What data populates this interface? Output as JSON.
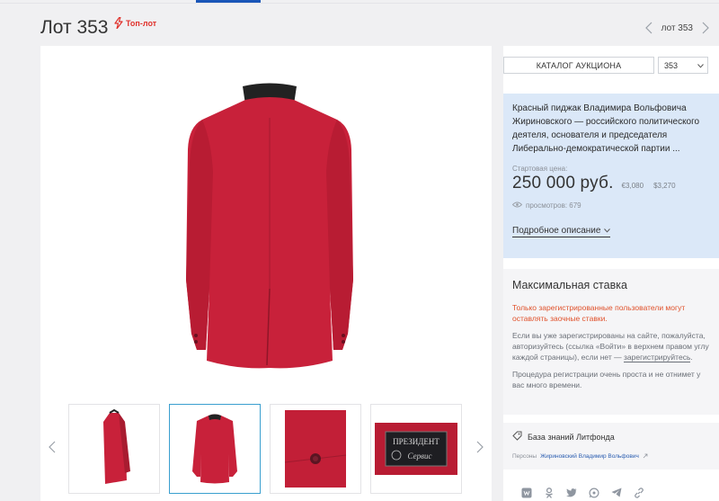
{
  "lot": {
    "title": "Лот 353",
    "badge": "Топ-лот"
  },
  "nav": {
    "lot_label": "лот 353"
  },
  "sidebar": {
    "catalog_button": "КАТАЛОГ АУКЦИОНА",
    "lot_select_value": "353",
    "description": "Красный пиджак Владимира Вольфовича Жириновского — российского политического деятеля, основателя и председателя Либерально-демократической партии ...",
    "start_price_label": "Стартовая цена:",
    "price": "250 000 руб.",
    "price_eur": "€3,080",
    "price_usd": "$3,270",
    "views": "просмотров: 679",
    "details_link": "Подробное описание"
  },
  "bid": {
    "title": "Максимальная ставка",
    "warning": "Только зарегистрированные пользователи могут оставлять заочные ставки.",
    "text_before_link": "Если вы уже зарегистрированы на сайте, пожалуйста, авторизуйтесь (ссылка «Войти» в верхнем правом углу каждой страницы), если нет — ",
    "register_link": "зарегистрируйтесь",
    "text_after_link": ".",
    "text2": "Процедура регистрации очень проста и не отнимет у вас много времени."
  },
  "knowledge": {
    "label": "База знаний Литфонда",
    "persons_label": "Персоны",
    "person_name": "Жириновский Владимир Вольфович"
  },
  "thumbnails": {
    "label_line1": "ПРЕЗИДЕНТ",
    "label_line2": "Сервис"
  },
  "colors": {
    "accent": "#1a56b8",
    "jacket": "#c8213a",
    "info_box": "#dbe8f8",
    "warning": "#e0512b",
    "badge": "#e0322c"
  },
  "icons": [
    "bolt-icon",
    "chevron-left-icon",
    "chevron-right-icon",
    "chevron-down-icon",
    "eye-icon",
    "tag-icon",
    "external-link-icon",
    "vk-icon",
    "ok-icon",
    "twitter-icon",
    "whatsapp-icon",
    "telegram-icon",
    "link-icon"
  ]
}
